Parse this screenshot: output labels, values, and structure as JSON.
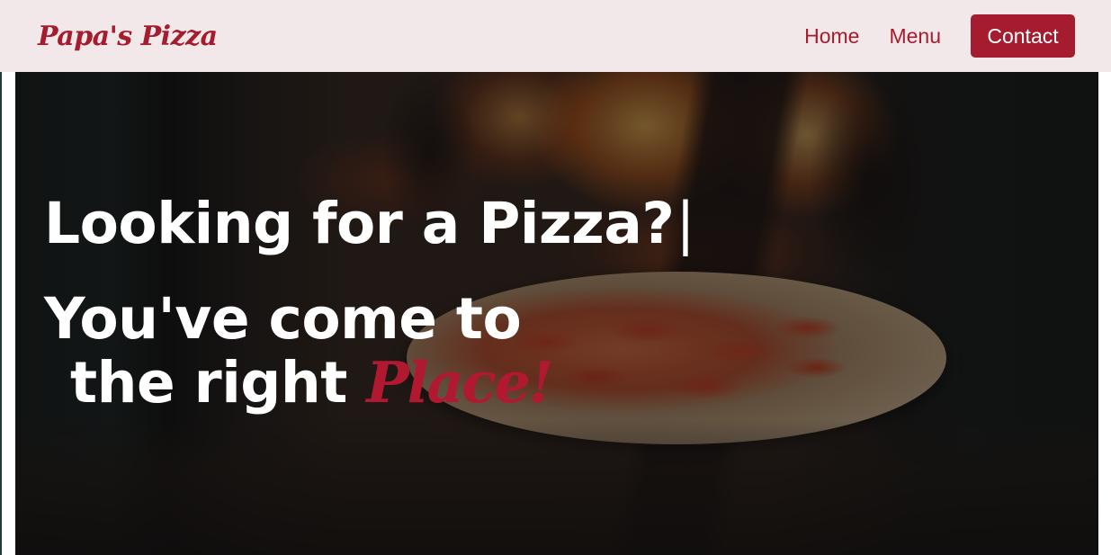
{
  "navbar": {
    "brand": "Papa's Pizza",
    "links": [
      {
        "label": "Home"
      },
      {
        "label": "Menu"
      }
    ],
    "contact_label": "Contact"
  },
  "hero": {
    "line1": "Looking for a Pizza?",
    "cursor": "|",
    "line2": "You've come to",
    "line3_prefix": "the right",
    "line3_accent": "Place!"
  },
  "colors": {
    "brand": "#a51c2e",
    "navbar_bg": "#f2e8e9",
    "hero_text": "#ffffff"
  }
}
